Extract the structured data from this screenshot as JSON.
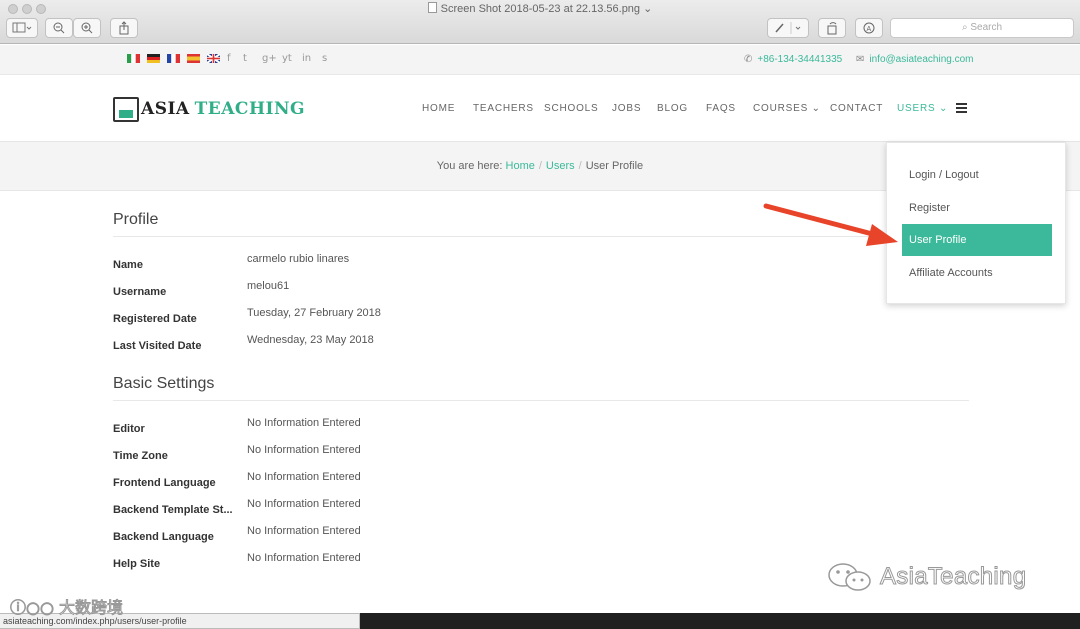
{
  "window": {
    "title": "Screen Shot 2018-05-23 at 22.13.56.png",
    "search_placeholder": "Search"
  },
  "topbar": {
    "phone": "+86-134-34441335",
    "email": "info@asiateaching.com",
    "flags": [
      "italy-flag-icon",
      "germany-flag-icon",
      "france-flag-icon",
      "spain-flag-icon",
      "uk-flag-icon"
    ],
    "social": [
      "f",
      "t",
      "g+",
      "yt",
      "in",
      "s"
    ]
  },
  "logo": {
    "part1": "ASIA",
    "part2": "TEACHING"
  },
  "nav": {
    "home": "HOME",
    "teachers": "TEACHERS",
    "schools": "SCHOOLS",
    "jobs": "JOBS",
    "blog": "BLOG",
    "faqs": "FAQS",
    "courses": "COURSES",
    "contact": "CONTACT",
    "users": "USERS"
  },
  "breadcrumb": {
    "prefix": "You are here:",
    "home": "Home",
    "users": "Users",
    "current": "User Profile"
  },
  "profile": {
    "title": "Profile",
    "rows": [
      {
        "label": "Name",
        "value": "carmelo rubio linares"
      },
      {
        "label": "Username",
        "value": "melou61"
      },
      {
        "label": "Registered Date",
        "value": "Tuesday, 27 February 2018"
      },
      {
        "label": "Last Visited Date",
        "value": "Wednesday, 23 May 2018"
      }
    ]
  },
  "basic_settings": {
    "title": "Basic Settings",
    "rows": [
      {
        "label": "Editor",
        "value": "No Information Entered"
      },
      {
        "label": "Time Zone",
        "value": "No Information Entered"
      },
      {
        "label": "Frontend Language",
        "value": "No Information Entered"
      },
      {
        "label": "Backend Template St...",
        "value": "No Information Entered"
      },
      {
        "label": "Backend Language",
        "value": "No Information Entered"
      },
      {
        "label": "Help Site",
        "value": "No Information Entered"
      }
    ]
  },
  "dropdown": {
    "items": [
      "Login / Logout",
      "Register",
      "User Profile",
      "Affiliate Accounts"
    ],
    "active": "User Profile"
  },
  "status_url": "asiateaching.com/index.php/users/user-profile",
  "watermarks": {
    "right": "AsiaTeaching",
    "left": "大数跨境"
  },
  "colors": {
    "accent": "#3bb99a",
    "arrow": "#e8442a"
  }
}
